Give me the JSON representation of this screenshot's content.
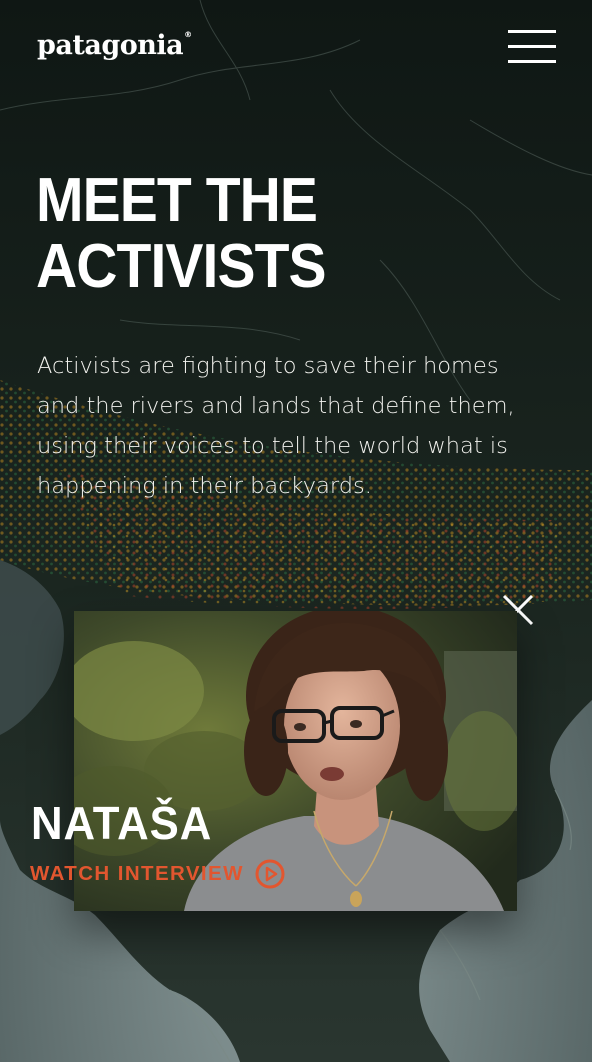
{
  "header": {
    "logo_text": "patagonia",
    "logo_mark": "®",
    "menu_icon": "hamburger-menu-icon"
  },
  "hero": {
    "title_line1": "MEET THE",
    "title_line2": "ACTIVISTS",
    "description": "Activists are fighting to save their homes and the rivers and lands that define them, using their voices to tell the world what is happening in their backyards."
  },
  "feature": {
    "name": "NATAŠA",
    "cta_label": "WATCH INTERVIEW",
    "cta_icon": "play-circle-icon",
    "close_icon": "close-icon"
  },
  "colors": {
    "background": "#101815",
    "accent": "#e2562f",
    "text": "#ffffff"
  }
}
